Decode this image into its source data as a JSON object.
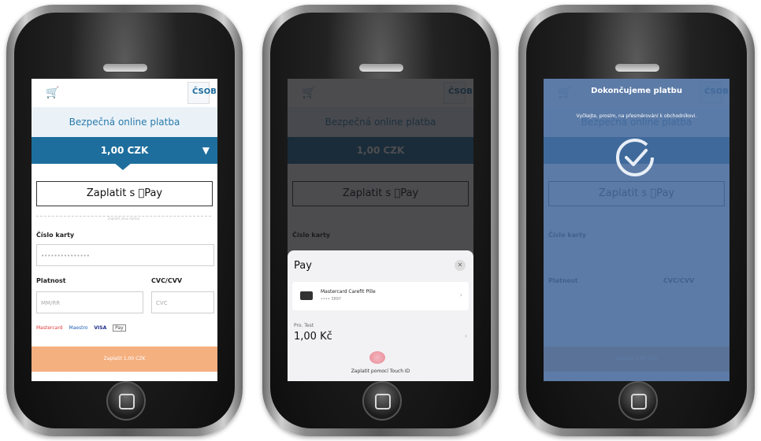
{
  "checkout": {
    "title": "Bezpečná online platba",
    "amount": "1,00 CZK",
    "dropdown_icon": "triangle-down-icon",
    "applepay_button": "Zaplatit s Pay",
    "divider": "Zaplatit jinou kartou",
    "card_number_label": "Číslo karty",
    "card_number_placeholder": "•••••••••••••••",
    "expiry_label": "Platnost",
    "expiry_placeholder": "MM/RR",
    "cvc_label": "CVC/CVV",
    "cvc_placeholder": "CVC",
    "brands": [
      "Mastercard",
      "Maestro",
      "VISA",
      "Pay"
    ],
    "submit": "Zaplatit 1,00 CZK"
  },
  "applepay_sheet": {
    "title": "Pay",
    "card_name": "Mastercard Carefit Plíle",
    "card_number": "•••• 3897",
    "merchant": "Pro. Test",
    "total": "1,00 Kč",
    "touch_id": "Zaplatit pomocí Touch ID"
  },
  "finishing": {
    "title": "Dokončujeme platbu",
    "subtitle": "Vyčkejte, prosím, na přesměrování k obchodníkovi."
  },
  "colors": {
    "brand_blue": "#1e6e9d",
    "title_band": "#eaf2f8",
    "submit": "#f5b080",
    "finish_overlay": "#46699b"
  }
}
